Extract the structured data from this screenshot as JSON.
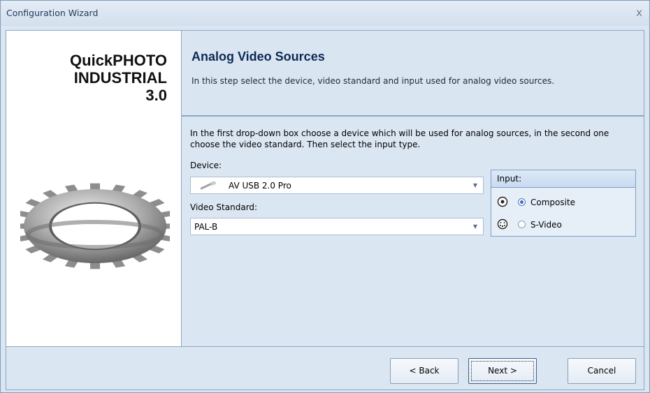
{
  "window": {
    "title": "Configuration Wizard",
    "close_glyph": "x"
  },
  "brand": {
    "line1": "QuickPHOTO",
    "line2": "INDUSTRIAL",
    "line3": "3.0"
  },
  "header": {
    "title": "Analog Video Sources",
    "description": "In this step select the device, video standard and input used for analog video sources."
  },
  "content": {
    "intro": "In the first drop-down box choose a device which will be used for analog sources, in the second one choose the video standard. Then select the input type.",
    "device_label": "Device:",
    "device_value": "AV USB 2.0 Pro",
    "device_icon": "usb-stick-icon",
    "standard_label": "Video Standard:",
    "standard_value": "PAL-B"
  },
  "input_group": {
    "title": "Input:",
    "options": [
      {
        "label": "Composite",
        "selected": true,
        "icon": "composite-connector-icon"
      },
      {
        "label": "S-Video",
        "selected": false,
        "icon": "svideo-connector-icon"
      }
    ]
  },
  "buttons": {
    "back": "< Back",
    "next": "Next >",
    "cancel": "Cancel"
  },
  "colors": {
    "header_title": "#0e2b55",
    "panel_border": "#8ba6c4",
    "accent_radio": "#3b6db6"
  }
}
